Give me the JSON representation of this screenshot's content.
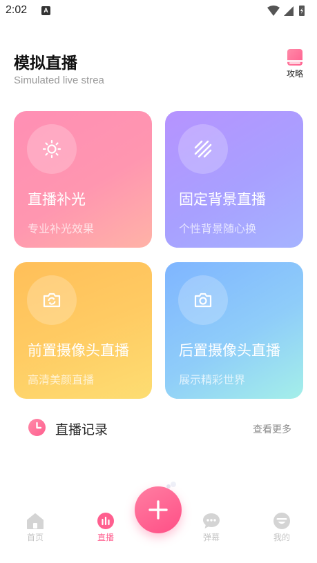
{
  "status_bar": {
    "time": "2:02",
    "notification_badge": "A"
  },
  "header": {
    "title": "模拟直播",
    "subtitle": "Simulated live strea",
    "guide_label": "攻略",
    "guide_icon": "book-icon"
  },
  "cards": [
    {
      "title": "直播补光",
      "desc": "专业补光效果",
      "icon": "sun-icon",
      "color": "#ff8fb4"
    },
    {
      "title": "固定背景直播",
      "desc": "个性背景随心换",
      "icon": "stripes-icon",
      "color": "#b693ff"
    },
    {
      "title": "前置摄像头直播",
      "desc": "高清美颜直播",
      "icon": "camera-switch-icon",
      "color": "#ffc35c"
    },
    {
      "title": "后置摄像头直播",
      "desc": "展示精彩世界",
      "icon": "camera-icon",
      "color": "#86bdfd"
    }
  ],
  "record": {
    "label": "直播记录",
    "more": "查看更多",
    "icon": "clock-icon"
  },
  "nav": {
    "items": [
      {
        "label": "首页",
        "icon": "home-icon",
        "active": false
      },
      {
        "label": "直播",
        "icon": "live-stats-icon",
        "active": true
      },
      {
        "label": "弹幕",
        "icon": "chat-bubble-icon",
        "active": false
      },
      {
        "label": "我的",
        "icon": "profile-icon",
        "active": false
      }
    ],
    "fab_icon": "plus-icon"
  },
  "colors": {
    "accent": "#ff5f8f",
    "inactive_nav": "#c4c4c4",
    "subtitle": "#9a9a9a"
  }
}
